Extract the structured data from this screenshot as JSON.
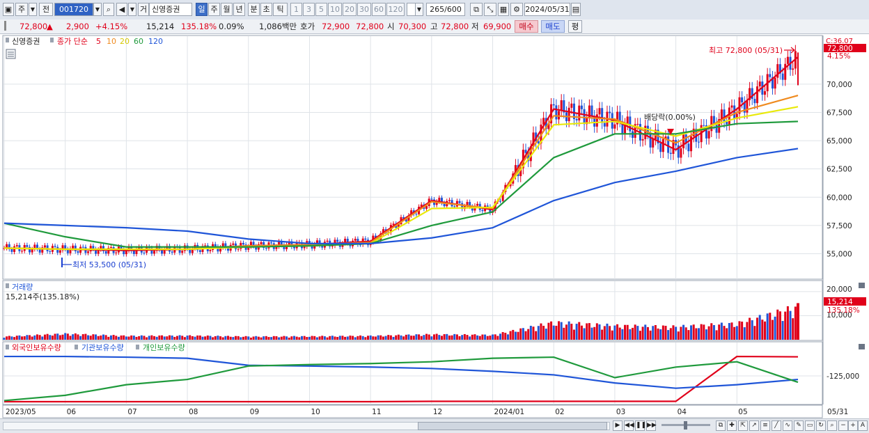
{
  "toolbar": {
    "mode_left": "주",
    "mode_right": "전",
    "code": "001720",
    "kind": "거",
    "name": "신영증권",
    "periods": [
      "일",
      "주",
      "월",
      "년",
      "분",
      "초",
      "틱"
    ],
    "period_selected": "일",
    "intervals": [
      "1",
      "3",
      "5",
      "10",
      "20",
      "30",
      "60",
      "120"
    ],
    "count": "265",
    "count_max": "/600",
    "date": "2024/05/31"
  },
  "quote": {
    "price": "72,800",
    "arrow": "▲",
    "change": "2,900",
    "change_pct": "+4.15%",
    "volume": "15,214",
    "volume_ratio": "135.18%",
    "turnover_pct": "0.09%",
    "amount": "1,086백만",
    "bid_label": "호가",
    "bid": "72,900",
    "ask": "72,800",
    "open_label": "시",
    "open": "70,300",
    "high_label": "고",
    "high": "72,800",
    "low_label": "저",
    "low": "69,900",
    "buy": "매수",
    "sell": "매도",
    "eval": "평"
  },
  "price_panel": {
    "title": "신영증권",
    "ma_label": "종가 단순",
    "ma_periods": [
      {
        "label": "5",
        "color": "#e0001a"
      },
      {
        "label": "10",
        "color": "#ef8a1e"
      },
      {
        "label": "20",
        "color": "#e9e90a"
      },
      {
        "label": "60",
        "color": "#1f9a3c"
      },
      {
        "label": "120",
        "color": "#1f55d8"
      }
    ],
    "c_value": "C:36.07",
    "last_price": "72,800",
    "last_pct": "4.15%",
    "high_annotation": "최고 72,800 (05/31)",
    "low_annotation": "최저 53,500 (05/31)",
    "dividend_annotation": "배당락(0.00%)",
    "y_ticks": [
      "70,000",
      "67,500",
      "65,000",
      "62,500",
      "60,000",
      "57,500",
      "55,000"
    ]
  },
  "volume_panel": {
    "title": "거래량",
    "subtitle": "15,214주(135.18%)",
    "y_ticks": [
      "20,000",
      "10,000"
    ],
    "last_value": "15,214",
    "last_pct": "135.18%"
  },
  "holding_panel": {
    "legend": [
      {
        "label": "외국인보유수량",
        "color": "#e0001a"
      },
      {
        "label": "기관보유수량",
        "color": "#1f55d8"
      },
      {
        "label": "개인보유수량",
        "color": "#1f9a3c"
      }
    ],
    "y_tick": "-125,000"
  },
  "x_axis": {
    "labels": [
      "2023/05",
      "06",
      "07",
      "08",
      "09",
      "10",
      "11",
      "12",
      "2024/01",
      "02",
      "03",
      "04",
      "05"
    ],
    "right_label": "05/31"
  },
  "chart_data": [
    {
      "type": "line",
      "title": "신영증권",
      "x": [
        "2023/05",
        "06",
        "07",
        "08",
        "09",
        "10",
        "11",
        "12",
        "2024/01",
        "02",
        "03",
        "04",
        "05",
        "05/31"
      ],
      "series": [
        {
          "name": "5",
          "values": [
            55500,
            55400,
            55300,
            55400,
            55700,
            55800,
            56100,
            59700,
            58900,
            67800,
            66800,
            64200,
            67800,
            72400
          ]
        },
        {
          "name": "10",
          "values": [
            55500,
            55400,
            55400,
            55400,
            55700,
            55800,
            56000,
            59600,
            59000,
            67200,
            66900,
            64800,
            67500,
            69000
          ]
        },
        {
          "name": "20",
          "values": [
            55500,
            55400,
            55400,
            55400,
            55600,
            55700,
            55900,
            59000,
            59100,
            66400,
            66700,
            65400,
            67000,
            68000
          ]
        },
        {
          "name": "60",
          "values": [
            57700,
            56500,
            55600,
            55600,
            55600,
            55700,
            55900,
            57500,
            58700,
            63500,
            65600,
            65600,
            66500,
            66700
          ]
        },
        {
          "name": "120",
          "values": [
            57700,
            57500,
            57300,
            57000,
            56300,
            55900,
            55900,
            56400,
            57300,
            59700,
            61300,
            62300,
            63500,
            64300
          ]
        }
      ],
      "ylim": [
        53000,
        73500
      ],
      "y_ticks": [
        55000,
        57500,
        60000,
        62500,
        65000,
        67500,
        70000
      ],
      "high": 72800,
      "low": 53500
    },
    {
      "type": "bar",
      "title": "거래량",
      "x": [
        "2023/05",
        "06",
        "07",
        "08",
        "09",
        "10",
        "11",
        "12",
        "2024/01",
        "02",
        "03",
        "04",
        "05",
        "05/31"
      ],
      "values": [
        1500,
        2800,
        1800,
        1900,
        1500,
        1600,
        1800,
        2500,
        2200,
        8000,
        6500,
        6000,
        7500,
        15214
      ],
      "ylim": [
        0,
        22000
      ],
      "y_ticks": [
        10000,
        20000
      ]
    },
    {
      "type": "line",
      "title": "보유수량",
      "x": [
        "2023/05",
        "06",
        "07",
        "08",
        "09",
        "10",
        "11",
        "12",
        "2024/01",
        "02",
        "03",
        "04",
        "05",
        "05/31"
      ],
      "series": [
        {
          "name": "외국인보유수량",
          "values": [
            -198000,
            -198000,
            -198000,
            -198000,
            -198000,
            -198000,
            -198000,
            -197000,
            -197000,
            -197000,
            -197000,
            -197000,
            -70000,
            -71000
          ]
        },
        {
          "name": "기관보유수량",
          "values": [
            -70000,
            -70000,
            -72000,
            -75000,
            -95000,
            -97000,
            -100000,
            -104000,
            -112000,
            -122000,
            -145000,
            -160000,
            -150000,
            -135000
          ]
        },
        {
          "name": "개인보유수량",
          "values": [
            -195000,
            -180000,
            -150000,
            -135000,
            -97000,
            -93000,
            -90000,
            -85000,
            -75000,
            -72000,
            -130000,
            -100000,
            -85000,
            -143000
          ]
        }
      ],
      "ylim": [
        -200000,
        -60000
      ],
      "y_ticks": [
        -125000
      ]
    }
  ]
}
